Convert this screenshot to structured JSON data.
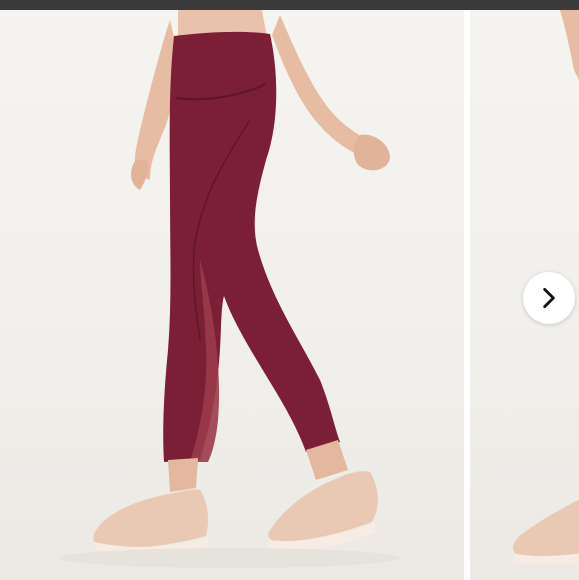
{
  "gallery": {
    "next_button": {
      "icon": "chevron-right-icon"
    },
    "main_image": {
      "subject": "burgundy-leggings-sneakers",
      "legging_color": "#7a1f35",
      "shoe_color": "#e9c8b4"
    },
    "next_image": {
      "subject": "sneaker-preview"
    }
  },
  "colors": {
    "background": "#f3f1ee",
    "legging": "#7a1f35",
    "mesh": "#9b3a4a",
    "skin": "#e8c0a8",
    "shoe": "#e9c8b4",
    "sole": "#f7ece4"
  }
}
